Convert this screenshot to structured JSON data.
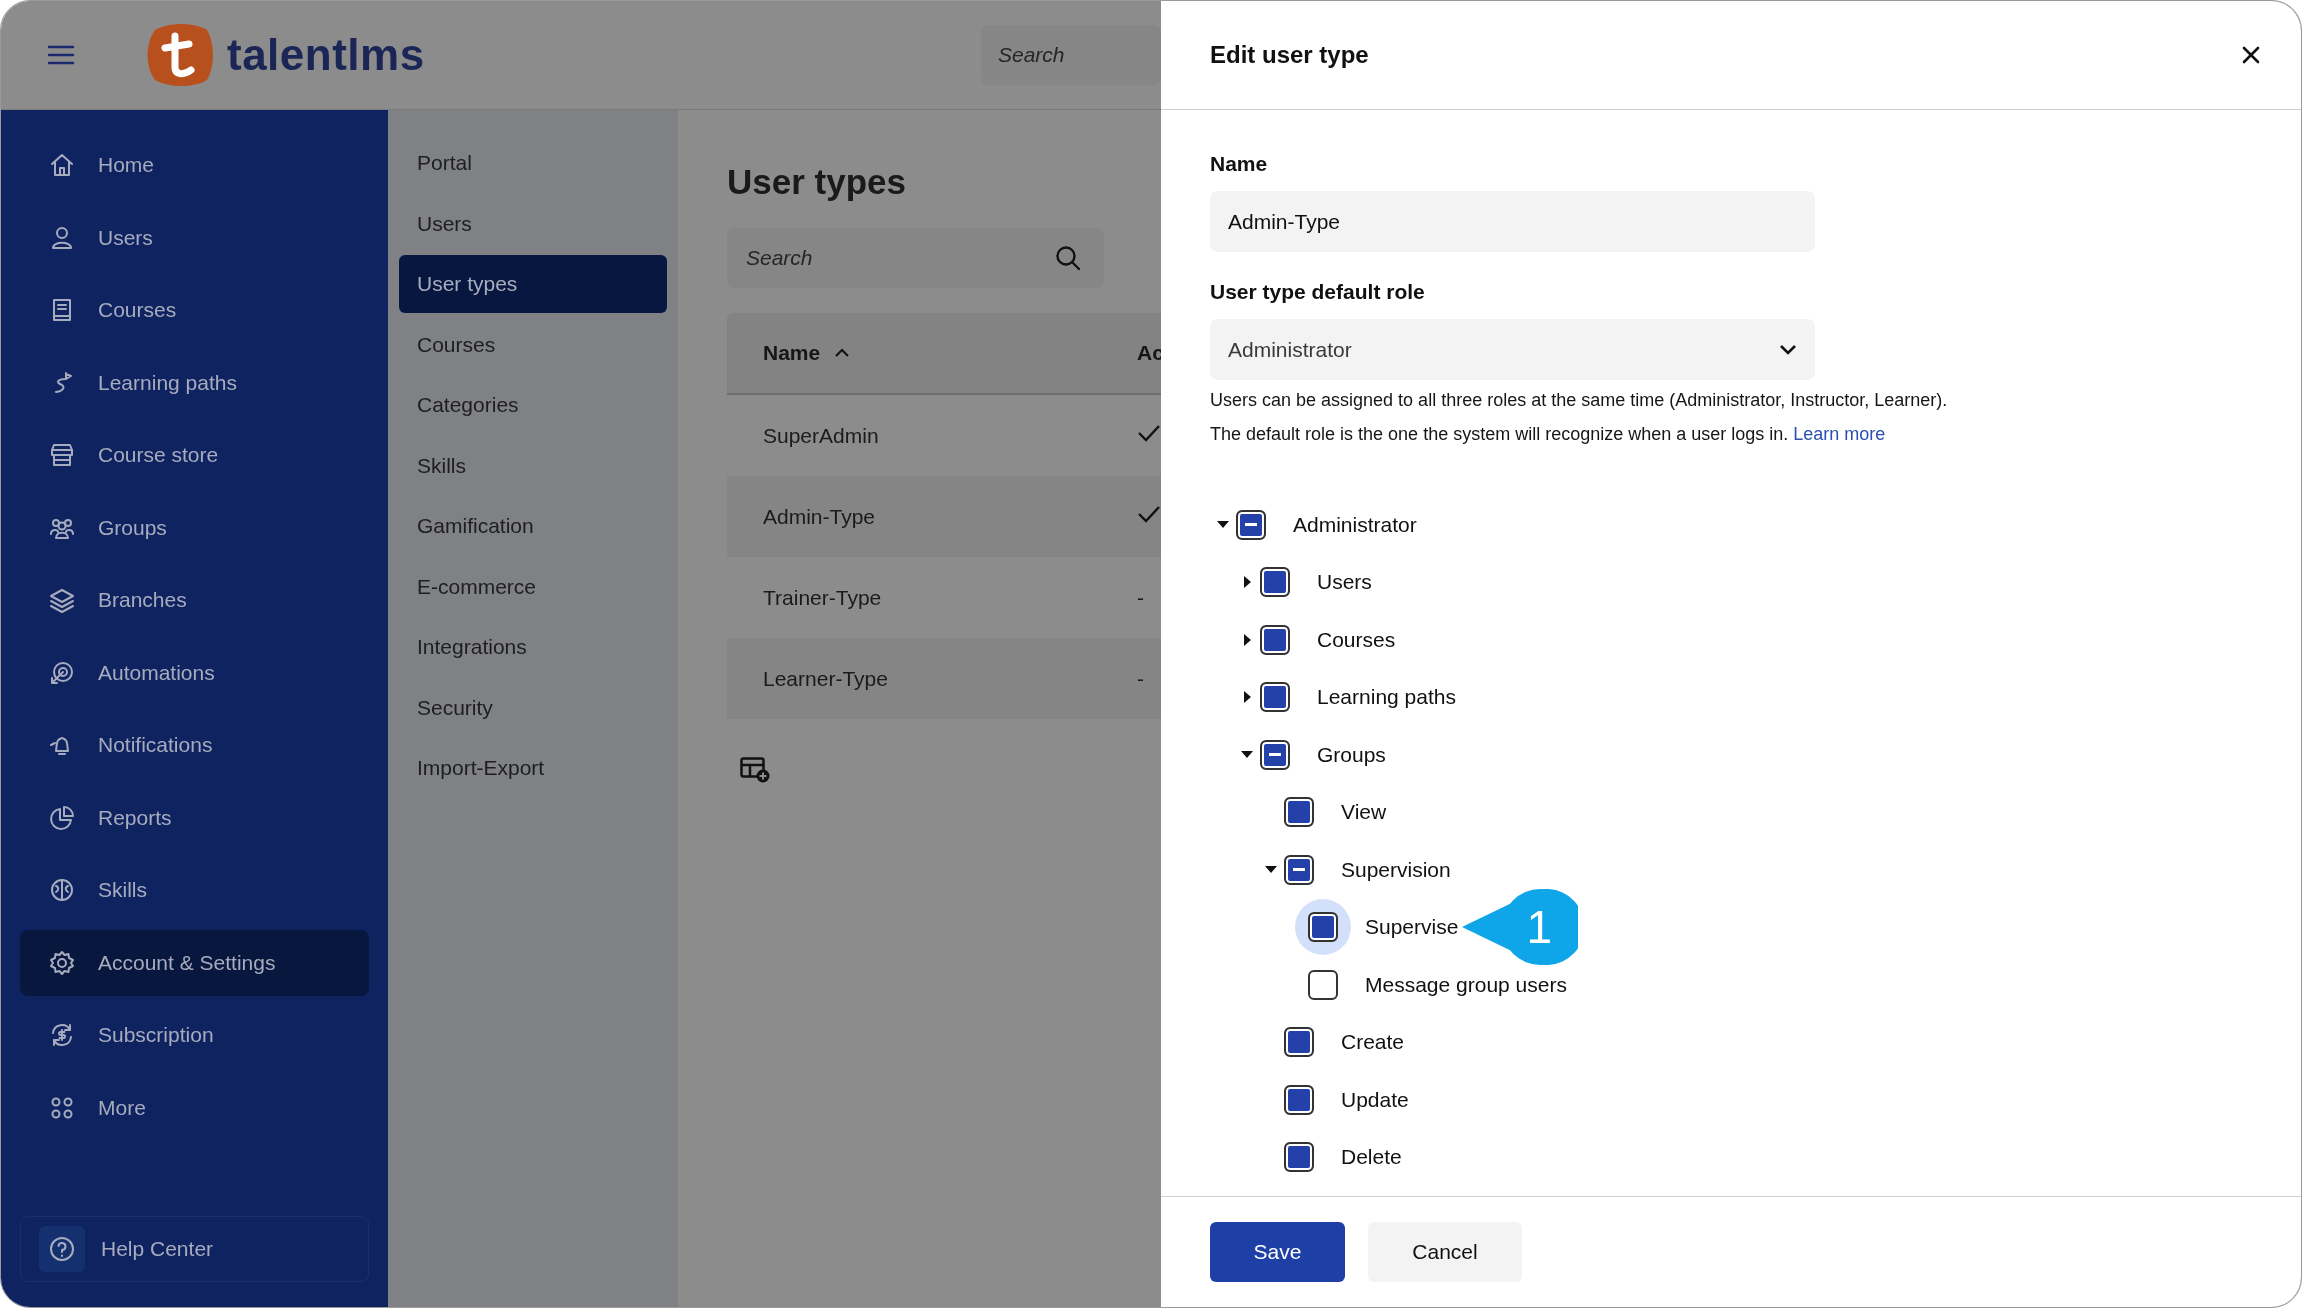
{
  "header": {
    "brand": "talentlms",
    "search": {
      "placeholder": "Search"
    }
  },
  "sidebar": {
    "items": [
      {
        "label": "Home",
        "selected": false
      },
      {
        "label": "Users",
        "selected": false
      },
      {
        "label": "Courses",
        "selected": false
      },
      {
        "label": "Learning paths",
        "selected": false
      },
      {
        "label": "Course store",
        "selected": false
      },
      {
        "label": "Groups",
        "selected": false
      },
      {
        "label": "Branches",
        "selected": false
      },
      {
        "label": "Automations",
        "selected": false
      },
      {
        "label": "Notifications",
        "selected": false
      },
      {
        "label": "Reports",
        "selected": false
      },
      {
        "label": "Skills",
        "selected": false
      },
      {
        "label": "Account & Settings",
        "selected": true
      },
      {
        "label": "Subscription",
        "selected": false
      },
      {
        "label": "More",
        "selected": false
      }
    ],
    "help": "Help Center"
  },
  "settings_nav": {
    "items": [
      {
        "label": "Portal",
        "selected": false
      },
      {
        "label": "Users",
        "selected": false
      },
      {
        "label": "User types",
        "selected": true
      },
      {
        "label": "Courses",
        "selected": false
      },
      {
        "label": "Categories",
        "selected": false
      },
      {
        "label": "Skills",
        "selected": false
      },
      {
        "label": "Gamification",
        "selected": false
      },
      {
        "label": "E-commerce",
        "selected": false
      },
      {
        "label": "Integrations",
        "selected": false
      },
      {
        "label": "Security",
        "selected": false
      },
      {
        "label": "Import-Export",
        "selected": false
      }
    ]
  },
  "page": {
    "title": "User types",
    "search": {
      "placeholder": "Search"
    },
    "table": {
      "columns": [
        {
          "label": "Name",
          "sorted": true
        },
        {
          "label": "Ac",
          "sorted": false
        }
      ],
      "rows": [
        {
          "name": "SuperAdmin",
          "column_2": {
            "kind": "check"
          }
        },
        {
          "name": "Admin-Type",
          "column_2": {
            "kind": "check"
          }
        },
        {
          "name": "Trainer-Type",
          "column_2": {
            "kind": "text",
            "text": "-"
          }
        },
        {
          "name": "Learner-Type",
          "column_2": {
            "kind": "text",
            "text": "-"
          }
        }
      ]
    }
  },
  "drawer": {
    "title": "Edit user type",
    "name_label": "Name",
    "name_value": "Admin-Type",
    "role_label": "User type default role",
    "role_value": "Administrator",
    "help_lines": [
      "Users can be assigned to all three roles at the same time (Administrator, Instructor, Learner).",
      "The default role is the one the system will recognize when a user logs in."
    ],
    "learn_more": "Learn more",
    "tree": [
      {
        "label": "Administrator",
        "checked": true,
        "indeterminate": true,
        "expandable": true,
        "expanded": true,
        "focused": false,
        "children": [
          {
            "label": "Users",
            "checked": true,
            "indeterminate": false,
            "expandable": true,
            "expanded": false,
            "focused": false
          },
          {
            "label": "Courses",
            "checked": true,
            "indeterminate": false,
            "expandable": true,
            "expanded": false,
            "focused": false
          },
          {
            "label": "Learning paths",
            "checked": true,
            "indeterminate": false,
            "expandable": true,
            "expanded": false,
            "focused": false
          },
          {
            "label": "Groups",
            "checked": true,
            "indeterminate": true,
            "expandable": true,
            "expanded": true,
            "focused": false,
            "children": [
              {
                "label": "View",
                "checked": true,
                "indeterminate": false,
                "expandable": false,
                "focused": false
              },
              {
                "label": "Supervision",
                "checked": true,
                "indeterminate": true,
                "expandable": true,
                "expanded": true,
                "focused": false,
                "children": [
                  {
                    "label": "Supervise",
                    "checked": true,
                    "indeterminate": false,
                    "expandable": false,
                    "focused": true,
                    "callout": "1"
                  },
                  {
                    "label": "Message group users",
                    "checked": false,
                    "indeterminate": false,
                    "expandable": false,
                    "focused": false
                  }
                ]
              },
              {
                "label": "Create",
                "checked": true,
                "indeterminate": false,
                "expandable": false,
                "focused": false
              },
              {
                "label": "Update",
                "checked": true,
                "indeterminate": false,
                "expandable": false,
                "focused": false
              },
              {
                "label": "Delete",
                "checked": true,
                "indeterminate": false,
                "expandable": false,
                "focused": false
              }
            ]
          }
        ]
      }
    ],
    "buttons": [
      {
        "label": "Save",
        "kind": "primary"
      },
      {
        "label": "Cancel",
        "kind": "secondary"
      }
    ]
  }
}
